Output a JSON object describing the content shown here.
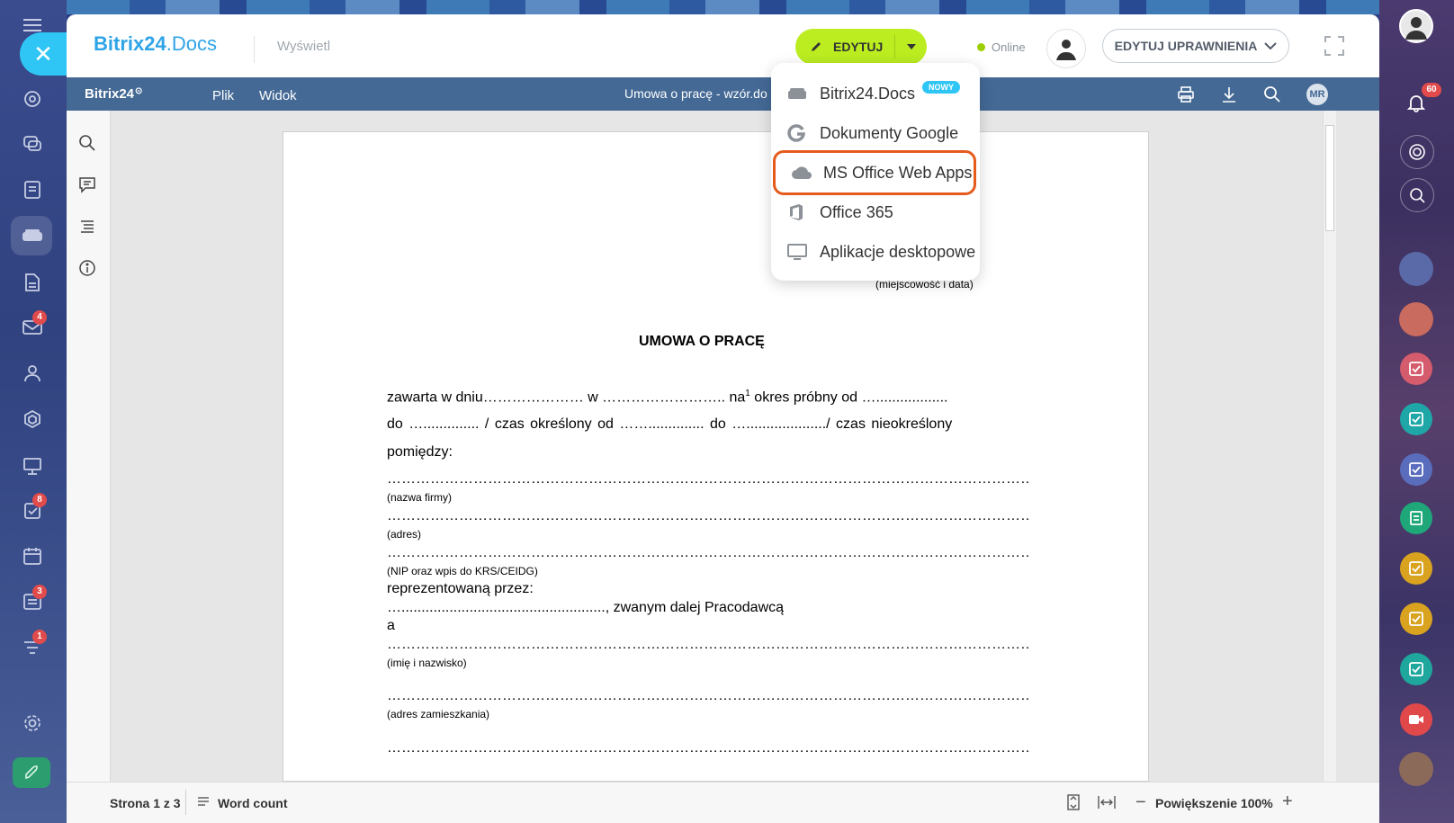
{
  "left_rail": {
    "badges": {
      "mail": "4",
      "tasks": "8",
      "feed": "3",
      "funnel": "1"
    }
  },
  "right_rail": {
    "notifications_badge": "60"
  },
  "header": {
    "logo_brand": "Bitrix24",
    "logo_docs": ".Docs",
    "view_label": "Wyświetl",
    "edit_label": "EDYTUJ",
    "online_label": "Online",
    "permissions_label": "EDYTUJ UPRAWNIENIA"
  },
  "menu": {
    "items": [
      {
        "label": "Bitrix24.Docs",
        "icon": "bitrix-drive-icon"
      },
      {
        "label": "Dokumenty Google",
        "icon": "google-icon"
      },
      {
        "label": "MS Office Web Apps",
        "icon": "cloud-icon"
      },
      {
        "label": "Office 365",
        "icon": "office-icon"
      },
      {
        "label": "Aplikacje desktopowe",
        "icon": "monitor-icon"
      }
    ],
    "new_badge": "NOWY"
  },
  "editor": {
    "logo": "Bitrix24",
    "menu_file": "Plik",
    "menu_view": "Widok",
    "doc_title": "Umowa o pracę - wzór.do",
    "user_initials": "MR"
  },
  "document": {
    "place_date_caption": "(miejscowość i data)",
    "heading": "UMOWA O PRACĘ",
    "line1_a": "zawarta w dniu………………… w …………………….. na",
    "line1_sup": "1",
    "line1_b": " okres próbny od …..................",
    "line2": "do ….............. / czas określony od …….............. do …..................../ czas nieokreślony",
    "line3": "pomiędzy:",
    "company_caption": "(nazwa firmy)",
    "address_caption": "(adres)",
    "nip_caption": "(NIP oraz wpis do KRS/CEIDG)",
    "represented": "reprezentowaną przez:",
    "employer_line": "…..................................................., zwanym dalej Pracodawcą",
    "a": "a",
    "name_caption": "(imię i nazwisko)",
    "residence_caption": "(adres zamieszkania)"
  },
  "status_bar": {
    "page": "Strona 1 z 3",
    "word_count": "Word count",
    "zoom": "Powiększenie 100%"
  },
  "colors": {
    "accent_blue": "#2fc6f6",
    "edit_green": "#bbed21",
    "editor_bar": "#446995",
    "highlight": "#e55b1e"
  }
}
